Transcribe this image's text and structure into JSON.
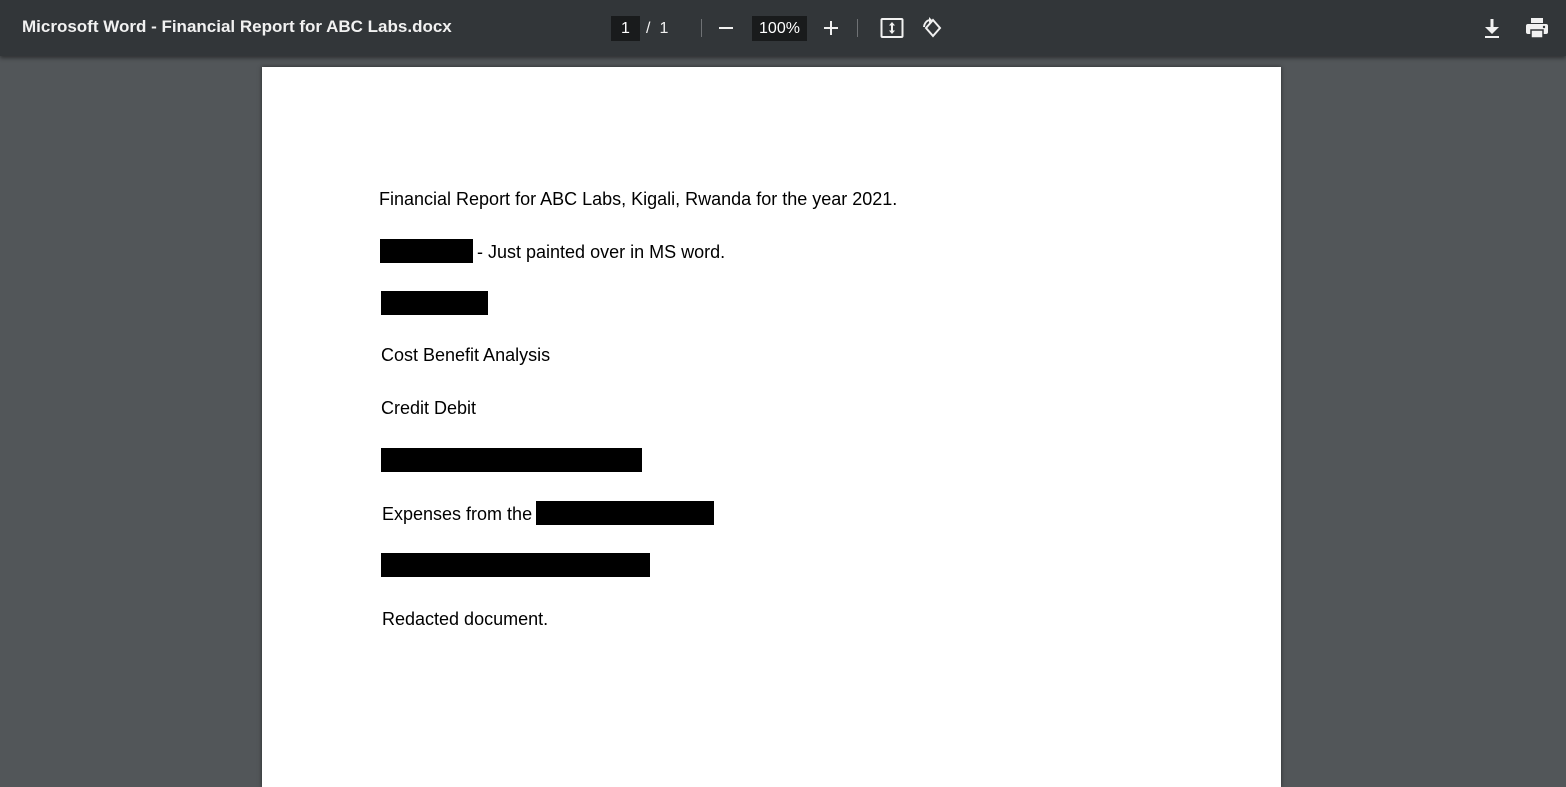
{
  "toolbar": {
    "title": "Microsoft Word - Financial Report for ABC Labs.docx",
    "current_page": "1",
    "page_separator": "/",
    "total_pages": "1",
    "zoom": "100%",
    "icons": {
      "zoom_out": "minus-icon",
      "zoom_in": "plus-icon",
      "fit": "fit-page-icon",
      "rotate": "rotate-icon",
      "download": "download-icon",
      "print": "print-icon"
    }
  },
  "document": {
    "line1": "Financial Report for ABC Labs, Kigali, Rwanda for the year 2021.",
    "line2_suffix": "- Just painted over in MS word.",
    "line4": "Cost Benefit Analysis",
    "line5": "Credit Debit",
    "line7_prefix": "Expenses from the",
    "line9": "Redacted document."
  },
  "colors": {
    "toolbar_bg": "#323639",
    "viewer_bg": "#525659",
    "page_bg": "#ffffff",
    "redaction": "#000000"
  }
}
